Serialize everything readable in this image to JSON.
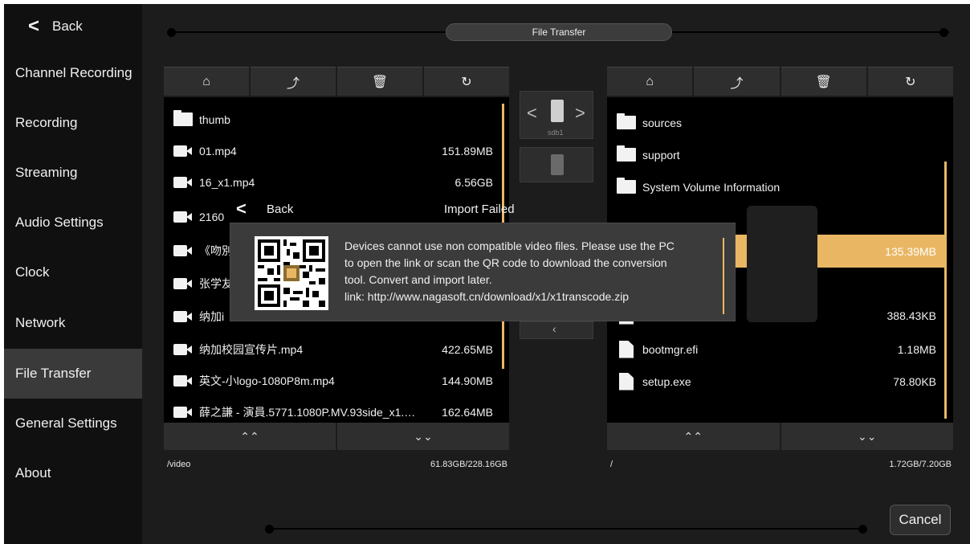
{
  "sidebar": {
    "back_label": "Back",
    "items": [
      {
        "label": "Channel Recording"
      },
      {
        "label": "Recording"
      },
      {
        "label": "Streaming"
      },
      {
        "label": "Audio Settings"
      },
      {
        "label": "Clock"
      },
      {
        "label": "Network"
      },
      {
        "label": "File Transfer"
      },
      {
        "label": "General Settings"
      },
      {
        "label": "About"
      }
    ],
    "active_item": "File Transfer"
  },
  "header": {
    "title": "File Transfer"
  },
  "left_panel": {
    "toolbar_icons": [
      "home-icon",
      "upload-icon",
      "trash-icon",
      "refresh-icon"
    ],
    "files": [
      {
        "type": "folder",
        "name": "thumb",
        "size": ""
      },
      {
        "type": "video",
        "name": "01.mp4",
        "size": "151.89MB"
      },
      {
        "type": "video",
        "name": "16_x1.mp4",
        "size": "6.56GB"
      },
      {
        "type": "video",
        "name": "2160",
        "size": ""
      },
      {
        "type": "video",
        "name": "《吻別",
        "size": ""
      },
      {
        "type": "video",
        "name": "张学友",
        "size": ""
      },
      {
        "type": "video",
        "name": "纳加i",
        "size": ""
      },
      {
        "type": "video",
        "name": "纳加校园宣传片.mp4",
        "size": "422.65MB"
      },
      {
        "type": "video",
        "name": "英文-小logo-1080P8m.mp4",
        "size": "144.90MB"
      },
      {
        "type": "video",
        "name": "薛之謙 - 演員.5771.1080P.MV.93side_x1.…",
        "size": "162.64MB"
      }
    ],
    "path": "/video",
    "space": "61.83GB/228.16GB"
  },
  "center": {
    "device_label": "sdb1"
  },
  "right_panel": {
    "toolbar_icons": [
      "home-icon",
      "upload-icon",
      "trash-icon",
      "refresh-icon"
    ],
    "files": [
      {
        "type": "folder",
        "name": "sources",
        "size": ""
      },
      {
        "type": "folder",
        "name": "support",
        "size": ""
      },
      {
        "type": "folder",
        "name": "System Volume Information",
        "size": ""
      },
      {
        "type": "blank",
        "name": "",
        "size": ""
      },
      {
        "type": "selected",
        "name": "",
        "size": "135.39MB"
      },
      {
        "type": "blank",
        "name": "",
        "size": ""
      },
      {
        "type": "file",
        "name": "",
        "size": "388.43KB"
      },
      {
        "type": "file",
        "name": "bootmgr.efi",
        "size": "1.18MB"
      },
      {
        "type": "file",
        "name": "setup.exe",
        "size": "78.80KB"
      }
    ],
    "path": "/",
    "space": "1.72GB/7.20GB"
  },
  "dialog": {
    "back_label": "Back",
    "title": "Import Failed",
    "message_lines": [
      "Devices cannot use non compatible video files. Please use the PC",
      "to open the link or scan the QR code to download the conversion",
      "tool. Convert and import later.",
      "link: http://www.nagasoft.cn/download/x1/x1transcode.zip"
    ]
  },
  "cancel_label": "Cancel",
  "colors": {
    "accent": "#e9b764",
    "panel_bg": "#000000",
    "button_bg": "#2e2e2e"
  }
}
